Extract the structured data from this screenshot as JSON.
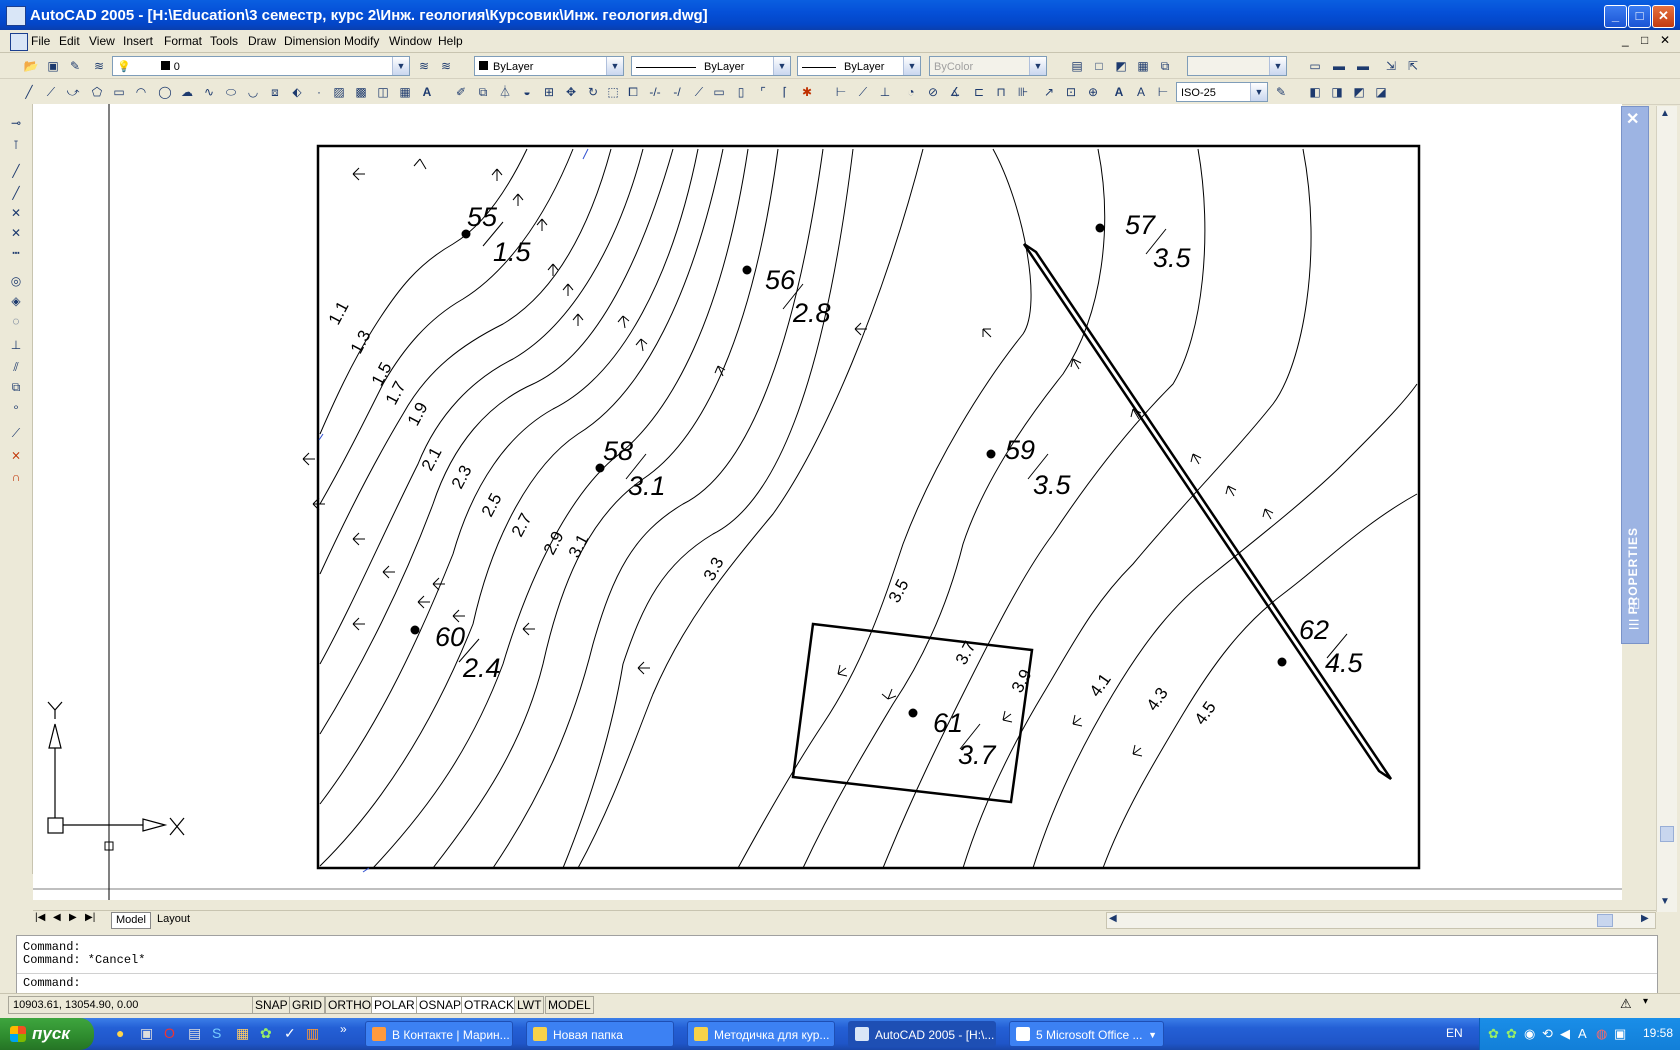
{
  "window": {
    "title": "AutoCAD 2005 - [H:\\Education\\3 семестр, курс 2\\Инж. геология\\Курсовик\\Инж. геология.dwg]",
    "controls": [
      "_",
      "□",
      "✕"
    ],
    "doc_controls": [
      "_",
      "□",
      "✕"
    ]
  },
  "menu": [
    "File",
    "Edit",
    "View",
    "Insert",
    "Format",
    "Tools",
    "Draw",
    "Dimension",
    "Modify",
    "Window",
    "Help"
  ],
  "toolbar": {
    "layer": "0",
    "color": "ByLayer",
    "linetype": "ByLayer",
    "lineweight": "ByLayer",
    "plotstyle": "ByColor",
    "dimstyle": "ISO-25"
  },
  "drawing": {
    "wells": [
      {
        "id": "55",
        "value": "1.5"
      },
      {
        "id": "56",
        "value": "2.8"
      },
      {
        "id": "57",
        "value": "3.5"
      },
      {
        "id": "58",
        "value": "3.1"
      },
      {
        "id": "59",
        "value": "3.5"
      },
      {
        "id": "60",
        "value": "2.4"
      },
      {
        "id": "61",
        "value": "3.7"
      },
      {
        "id": "62",
        "value": "4.5"
      }
    ],
    "contour_labels": [
      "1.1",
      "1.3",
      "1.5",
      "1.7",
      "1.9",
      "2.1",
      "2.3",
      "2.5",
      "2.7",
      "2.9",
      "3.1",
      "3.3",
      "3.5",
      "3.7",
      "3.9",
      "4.1",
      "4.3",
      "4.5"
    ],
    "ucs": {
      "x": "X",
      "y": "Y"
    }
  },
  "palette": {
    "title": "PROPERTIES"
  },
  "tabs": {
    "model": "Model",
    "layout": "Layout"
  },
  "command": {
    "line1": "Command:",
    "line2": "Command: *Cancel*",
    "prompt": "Command:"
  },
  "status": {
    "coords": "10903.61, 13054.90, 0.00",
    "buttons": [
      "SNAP",
      "GRID",
      "ORTHO",
      "POLAR",
      "OSNAP",
      "OTRACK",
      "LWT",
      "MODEL"
    ]
  },
  "taskbar": {
    "start": "пуск",
    "tasks": [
      "В Контакте | Марин...",
      "Новая папка",
      "Методичка для кур...",
      "AutoCAD 2005 - [H:\\...",
      "5 Microsoft Office ..."
    ],
    "lang": "EN",
    "clock": "19:58"
  },
  "colors": {
    "titlebar": "#0550d8",
    "canvas": "#ffffff",
    "taskbar": "#2460d6"
  }
}
